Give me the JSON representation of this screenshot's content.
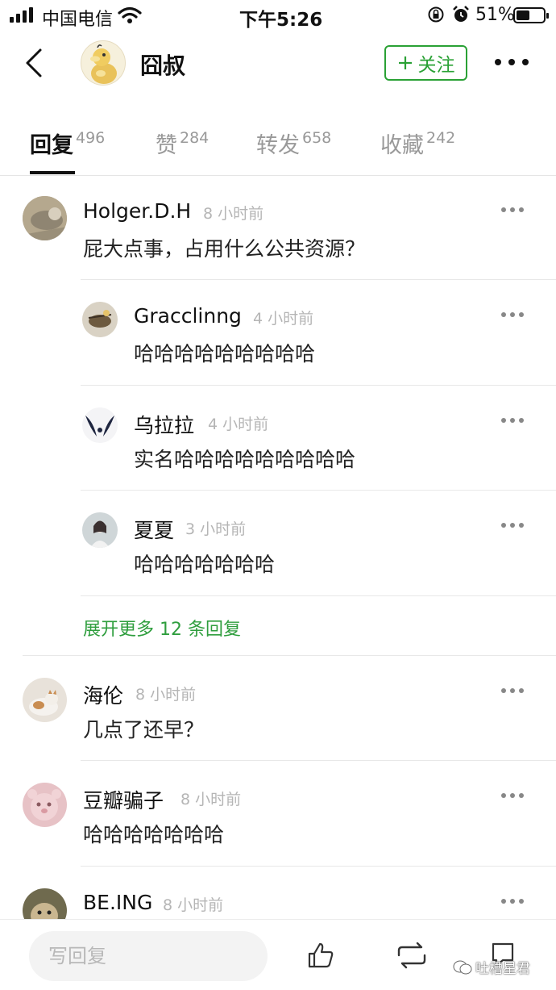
{
  "status_bar": {
    "carrier": "中国电信",
    "time": "下午5:26",
    "battery": "51%",
    "battery_level": 0.51
  },
  "header": {
    "username": "囧叔",
    "follow_label": "关注"
  },
  "tabs": [
    {
      "label": "回复",
      "count": "496"
    },
    {
      "label": "赞",
      "count": "284"
    },
    {
      "label": "转发",
      "count": "658"
    },
    {
      "label": "收藏",
      "count": "242"
    }
  ],
  "comments": [
    {
      "name": "Holger.D.H",
      "time": "8 小时前",
      "text": "屁大点事，占用什么公共资源？"
    },
    {
      "name": "Gracclinng",
      "time": "4 小时前",
      "text": "哈哈哈哈哈哈哈哈哈"
    },
    {
      "name": "乌拉拉",
      "time": "4 小时前",
      "text": "实名哈哈哈哈哈哈哈哈哈"
    },
    {
      "name": "夏夏",
      "time": "3 小时前",
      "text": "哈哈哈哈哈哈哈"
    },
    {
      "name": "海伦",
      "time": "8 小时前",
      "text": "几点了还早？"
    },
    {
      "name": "豆瓣骗子",
      "time": "8 小时前",
      "text": "哈哈哈哈哈哈哈"
    },
    {
      "name": "BE.ING",
      "time": "8 小时前",
      "text": ""
    }
  ],
  "expand_replies": "展开更多 12 条回复",
  "bottom_bar": {
    "reply_placeholder": "写回复",
    "watermark": "吐槽星君"
  }
}
